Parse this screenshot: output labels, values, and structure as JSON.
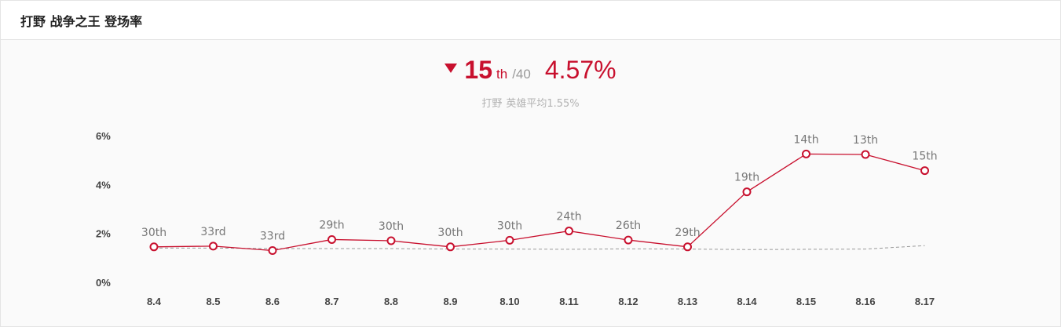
{
  "header": {
    "title": "打野 战争之王 登场率"
  },
  "summary": {
    "rank": "15",
    "rank_suffix": "th",
    "rank_total": "/40",
    "rate": "4.57%",
    "avg_role": "打野",
    "avg_text": "英雄平均1.55%",
    "trend": "down"
  },
  "colors": {
    "accent": "#c8102e",
    "average_line": "#999999",
    "muted": "#b3b3b3"
  },
  "chart_data": {
    "type": "line",
    "title": "",
    "xlabel": "",
    "ylabel": "",
    "categories": [
      "8.4",
      "8.5",
      "8.6",
      "8.7",
      "8.8",
      "8.9",
      "8.10",
      "8.11",
      "8.12",
      "8.13",
      "8.14",
      "8.15",
      "8.16",
      "8.17"
    ],
    "ylim": [
      0,
      6
    ],
    "yticks": [
      "0%",
      "2%",
      "4%",
      "6%"
    ],
    "grid": false,
    "series": [
      {
        "values": [
          1.45,
          1.48,
          1.3,
          1.75,
          1.7,
          1.45,
          1.72,
          2.1,
          1.73,
          1.45,
          3.7,
          5.25,
          5.23,
          4.57
        ],
        "labels": [
          "30th",
          "33rd",
          "33rd",
          "29th",
          "30th",
          "30th",
          "30th",
          "24th",
          "26th",
          "29th",
          "19th",
          "14th",
          "13th",
          "15th"
        ],
        "color": "#c8102e",
        "style": "solid"
      },
      {
        "values": [
          1.4,
          1.4,
          1.38,
          1.38,
          1.38,
          1.36,
          1.36,
          1.35,
          1.37,
          1.36,
          1.34,
          1.35,
          1.36,
          1.5
        ],
        "color": "#999999",
        "style": "dashed"
      }
    ]
  }
}
